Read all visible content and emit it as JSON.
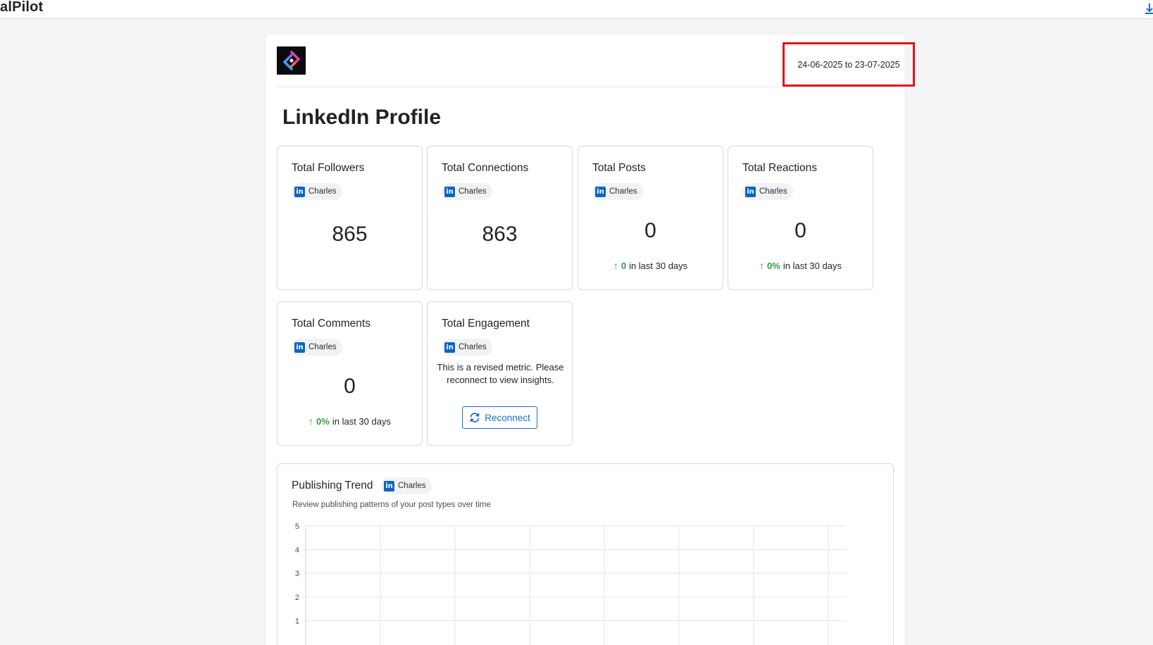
{
  "app": {
    "brand": "alPilot"
  },
  "report": {
    "date_range": "24-06-2025 to 23-07-2025",
    "title": "LinkedIn Profile"
  },
  "cards": [
    {
      "title": "Total Followers",
      "account": "Charles",
      "value": "865"
    },
    {
      "title": "Total Connections",
      "account": "Charles",
      "value": "863"
    },
    {
      "title": "Total Posts",
      "account": "Charles",
      "value": "0",
      "delta_value": "0",
      "delta_text": "in last 30 days"
    },
    {
      "title": "Total Reactions",
      "account": "Charles",
      "value": "0",
      "delta_value": "0%",
      "delta_text": "in last 30 days"
    },
    {
      "title": "Total Comments",
      "account": "Charles",
      "value": "0",
      "delta_value": "0%",
      "delta_text": "in last 30 days"
    },
    {
      "title": "Total Engagement",
      "account": "Charles",
      "note": "This is a revised metric. Please reconnect to view insights.",
      "button_label": "Reconnect"
    }
  ],
  "trend": {
    "title": "Publishing Trend",
    "account": "Charles",
    "subtitle": "Review publishing patterns of your post types over time"
  },
  "chart_data": {
    "type": "line",
    "title": "",
    "xlabel": "",
    "ylabel": "",
    "ylim": [
      0,
      5
    ],
    "y_ticks": [
      "5",
      "4",
      "3",
      "2",
      "1"
    ],
    "grid": true,
    "series": []
  },
  "colors": {
    "linkedin": "#0a66c2",
    "positive": "#2e9e47",
    "accent": "#1a6fd1",
    "highlight_box": "#e0141c"
  },
  "icons": {
    "linkedin": "linkedin-icon",
    "reconnect": "refresh-icon",
    "delta": "arrow-up-icon",
    "download": "download-icon"
  }
}
